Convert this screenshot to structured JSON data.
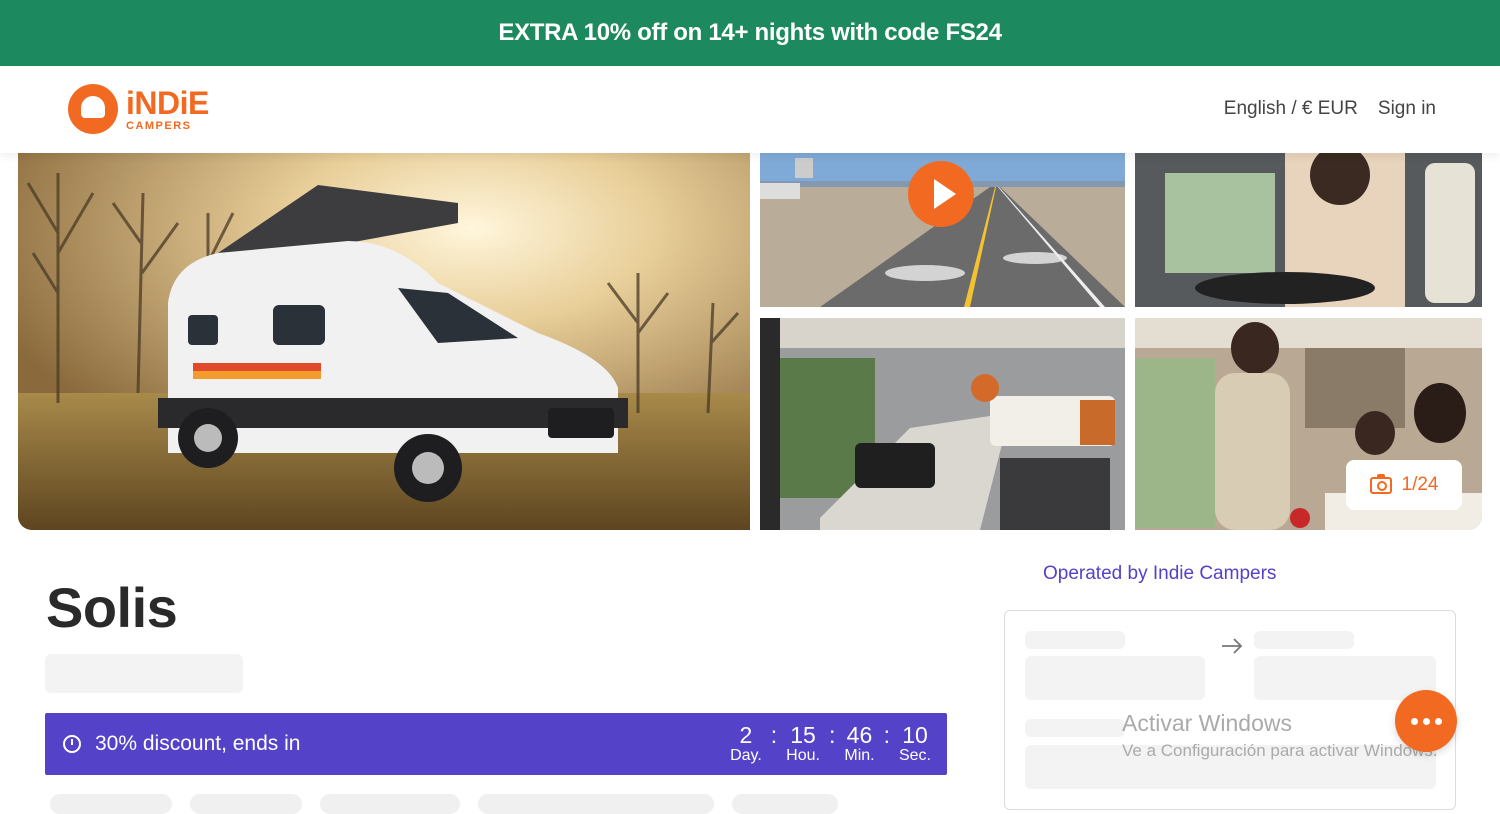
{
  "promo": {
    "text": "EXTRA 10% off on 14+ nights with code FS24"
  },
  "header": {
    "logo_word": "iNDiE",
    "logo_sub": "CAMPERS",
    "language_currency": "English / € EUR",
    "sign_in": "Sign in"
  },
  "gallery": {
    "photo_count": "1/24"
  },
  "vehicle": {
    "name": "Solis"
  },
  "discount": {
    "text": "30% discount, ends in",
    "countdown": [
      {
        "value": "2",
        "label": "Day."
      },
      {
        "value": "15",
        "label": "Hou."
      },
      {
        "value": "46",
        "label": "Min."
      },
      {
        "value": "10",
        "label": "Sec."
      }
    ]
  },
  "sidebar": {
    "operated_by": "Operated by Indie Campers"
  },
  "windows_watermark": {
    "title": "Activar Windows",
    "subtitle": "Ve a Configuración para activar Windows."
  },
  "colors": {
    "brand": "#f26a21",
    "promo_bg": "#1c8a5e",
    "accent": "#5442c8"
  }
}
